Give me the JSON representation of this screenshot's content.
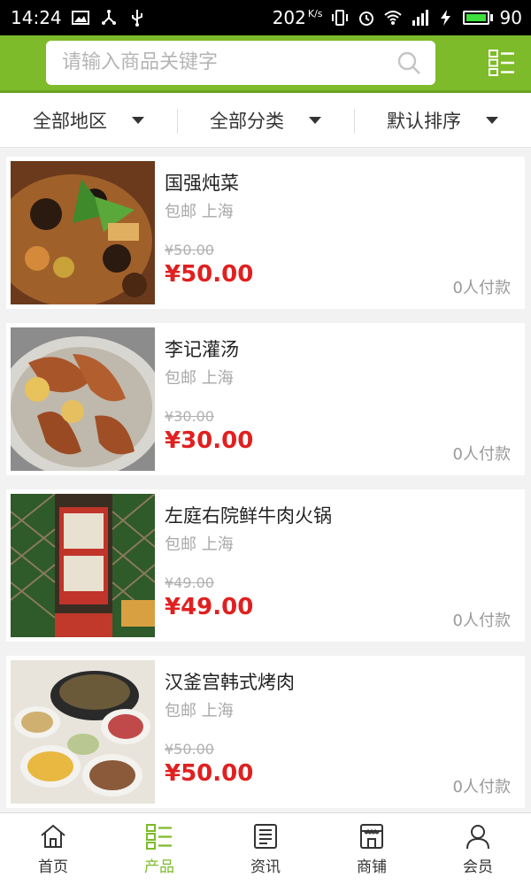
{
  "status_bar": {
    "time": "14:24",
    "net_speed": "202",
    "net_unit": "K/s",
    "battery": "90"
  },
  "search": {
    "placeholder": "请输入商品关键字"
  },
  "filters": [
    {
      "label": "全部地区"
    },
    {
      "label": "全部分类"
    },
    {
      "label": "默认排序"
    }
  ],
  "products": [
    {
      "name": "国强炖菜",
      "shipping": "包邮 上海",
      "original_price": "¥50.00",
      "price": "¥50.00",
      "paid": "0人付款"
    },
    {
      "name": "李记灌汤",
      "shipping": "包邮 上海",
      "original_price": "¥30.00",
      "price": "¥30.00",
      "paid": "0人付款"
    },
    {
      "name": "左庭右院鲜牛肉火锅",
      "shipping": "包邮 上海",
      "original_price": "¥49.00",
      "price": "¥49.00",
      "paid": "0人付款"
    },
    {
      "name": "汉釜宫韩式烤肉",
      "shipping": "包邮 上海",
      "original_price": "¥50.00",
      "price": "¥50.00",
      "paid": "0人付款"
    }
  ],
  "nav": [
    {
      "label": "首页",
      "icon": "home-icon"
    },
    {
      "label": "产品",
      "icon": "grid-list-icon"
    },
    {
      "label": "资讯",
      "icon": "news-icon"
    },
    {
      "label": "商铺",
      "icon": "shop-icon"
    },
    {
      "label": "会员",
      "icon": "user-icon"
    }
  ],
  "colors": {
    "brand": "#7dbb2a",
    "price": "#e02020"
  }
}
